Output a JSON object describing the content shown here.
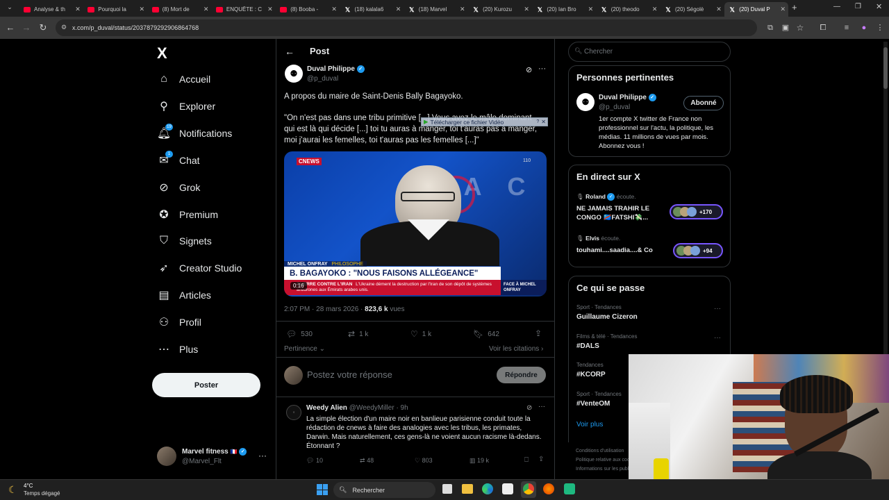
{
  "browser": {
    "tabs": [
      {
        "title": "Analyse & th",
        "type": "yt"
      },
      {
        "title": "Pourquoi la",
        "type": "yt"
      },
      {
        "title": "(8) Mort de",
        "type": "yt"
      },
      {
        "title": "ENQUÊTE : C",
        "type": "yt"
      },
      {
        "title": "(8) Booba -",
        "type": "yt"
      },
      {
        "title": "(18) kalala6",
        "type": "x"
      },
      {
        "title": "(18) Marvel",
        "type": "x"
      },
      {
        "title": "(20) Kurozu",
        "type": "x"
      },
      {
        "title": "(20) Ian Bro",
        "type": "x"
      },
      {
        "title": "(20) theodo",
        "type": "x"
      },
      {
        "title": "(20) Ségolè",
        "type": "x"
      },
      {
        "title": "(20) Duval P",
        "type": "x",
        "active": true
      }
    ],
    "url": "x.com/p_duval/status/2037879292906864768"
  },
  "nav": {
    "logo": "X",
    "items": [
      {
        "label": "Accueil",
        "icon": "home-icon"
      },
      {
        "label": "Explorer",
        "icon": "search-icon"
      },
      {
        "label": "Notifications",
        "icon": "bell-icon",
        "badge": "19"
      },
      {
        "label": "Chat",
        "icon": "mail-icon",
        "badge": "1"
      },
      {
        "label": "Grok",
        "icon": "grok-icon"
      },
      {
        "label": "Premium",
        "icon": "premium-icon"
      },
      {
        "label": "Signets",
        "icon": "bookmark-icon"
      },
      {
        "label": "Creator Studio",
        "icon": "rocket-icon"
      },
      {
        "label": "Articles",
        "icon": "article-icon"
      },
      {
        "label": "Profil",
        "icon": "person-icon"
      },
      {
        "label": "Plus",
        "icon": "more-circle-icon"
      }
    ],
    "post_button": "Poster",
    "account": {
      "name": "Marvel fitness",
      "flag": "🇫🇷",
      "handle": "@Marvel_Flt"
    }
  },
  "post": {
    "header": "Post",
    "author": {
      "name": "Duval Philippe",
      "handle": "@p_duval"
    },
    "text_line1": "A propos du maire de Saint-Denis Bally Bagayoko.",
    "text_quote": "\"On n'est pas dans une tribu primitive [...] Vous avez le mâle dominant qui est là qui décide [...] toi tu auras à manger, toi t'auras pas à manger, moi j'aurai les femelles, toi t'auras pas les femelles [...]\"",
    "download_overlay": "Télécharger ce fichier Vidéo",
    "video": {
      "channel": "CNEWS",
      "channel_num": "110",
      "speaker": "MICHEL ONFRAY",
      "speaker_role": "PHILOSOPHE",
      "headline": "B. BAGAYOKO : \"NOUS FAISONS ALLÉGEANCE\"",
      "ticker_label": "GUERRE CONTRE L'IRAN",
      "ticker_text": "L'Ukraine dément la destruction par l'Iran de son dépôt de systèmes antidrones aux Émirats arabes unis.",
      "side_label": "FACE À MICHEL ONFRAY",
      "bg_letters": "F A C",
      "duration": "0:16"
    },
    "meta_time": "2:07 PM · 28 mars 2026 · ",
    "meta_views": "823,6 k",
    "meta_views_label": "vues",
    "stats": {
      "replies": "530",
      "reposts": "1 k",
      "likes": "1 k",
      "bookmarks": "642"
    },
    "pertinence": "Pertinence",
    "voir_citations": "Voir les citations",
    "reply_placeholder": "Postez votre réponse",
    "reply_button": "Répondre"
  },
  "reply_post": {
    "name": "Weedy Alien",
    "handle": "@WeedyMiller",
    "time": "· 9h",
    "text": "La simple élection d'un maire noir en banlieue parisienne conduit toute la rédaction de cnews à faire des analogies avec les tribus, les primates, Darwin. Mais naturellement, ces gens-là ne voient aucun racisme là-dedans. Étonnant ?",
    "stats": {
      "replies": "10",
      "reposts": "48",
      "likes": "803",
      "views": "19 k"
    }
  },
  "right": {
    "search_placeholder": "Chercher",
    "relevant": {
      "title": "Personnes pertinentes",
      "name": "Duval Philippe",
      "handle": "@p_duval",
      "follow_label": "Abonné",
      "bio": "1er compte X twitter de France non professionnel sur l'actu, la politique, les médias. 11 millions de vues par mois. Abonnez vous !"
    },
    "live": {
      "title": "En direct sur X",
      "items": [
        {
          "host": "Roland",
          "status": "écoute.",
          "title": "NE JAMAIS TRAHIR LE CONGO 🇨🇩FATSHI💸...",
          "count": "+170"
        },
        {
          "host": "Elvis",
          "status": "écoute.",
          "title": "touhami....saadia....& Co",
          "count": "+94"
        }
      ]
    },
    "trends": {
      "title": "Ce qui se passe",
      "items": [
        {
          "context": "Sport · Tendances",
          "name": "Guillaume Cizeron"
        },
        {
          "context": "Films & télé · Tendances",
          "name": "#DALS"
        },
        {
          "context": "Tendances",
          "name": "#KCORP"
        },
        {
          "context": "Sport · Tendances",
          "name": "#VenteOM"
        }
      ],
      "more": "Voir plus"
    },
    "footer": [
      "Conditions d'utilisation",
      "Politique relative aux cookies",
      "Informations sur les publicités"
    ]
  },
  "taskbar": {
    "weather_temp": "4°C",
    "weather_text": "Temps dégagé",
    "search_label": "Rechercher"
  }
}
